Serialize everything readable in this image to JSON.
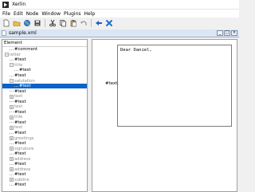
{
  "window": {
    "title": "Xerlin"
  },
  "menu": [
    "File",
    "Edit",
    "Node",
    "Window",
    "Plugins",
    "Help"
  ],
  "toolbar": {
    "buttons": [
      "new-icon",
      "open-icon",
      "globe-icon",
      "save-icon",
      "cut-icon",
      "copy-icon",
      "paste-icon",
      "undo-icon",
      "back-arrow-icon",
      "delete-x-icon"
    ]
  },
  "document": {
    "tab_title": "sample.xml",
    "win_controls": [
      "_",
      "□",
      "×"
    ]
  },
  "tree": {
    "header": "Element",
    "rows": [
      {
        "label": "#comment",
        "indent": 1,
        "type": "leaf",
        "gray": false
      },
      {
        "label": "letter",
        "indent": 0,
        "type": "minus",
        "gray": true
      },
      {
        "label": "#text",
        "indent": 1,
        "type": "leaf",
        "gray": false
      },
      {
        "label": "title",
        "indent": 1,
        "type": "minus",
        "gray": true
      },
      {
        "label": "#text",
        "indent": 2,
        "type": "leaf",
        "gray": false
      },
      {
        "label": "#text",
        "indent": 1,
        "type": "leaf",
        "gray": false
      },
      {
        "label": "salutation",
        "indent": 1,
        "type": "minus",
        "gray": true
      },
      {
        "label": "#text",
        "indent": 2,
        "type": "leaf",
        "gray": false,
        "selected": true
      },
      {
        "label": "#text",
        "indent": 1,
        "type": "leaf",
        "gray": false
      },
      {
        "label": "text",
        "indent": 1,
        "type": "plus",
        "gray": true
      },
      {
        "label": "#text",
        "indent": 1,
        "type": "leaf",
        "gray": false
      },
      {
        "label": "text",
        "indent": 1,
        "type": "plus",
        "gray": true
      },
      {
        "label": "#text",
        "indent": 1,
        "type": "leaf",
        "gray": false
      },
      {
        "label": "title",
        "indent": 1,
        "type": "plus",
        "gray": true
      },
      {
        "label": "#text",
        "indent": 1,
        "type": "leaf",
        "gray": false
      },
      {
        "label": "text",
        "indent": 1,
        "type": "plus",
        "gray": true
      },
      {
        "label": "#text",
        "indent": 1,
        "type": "leaf",
        "gray": false
      },
      {
        "label": "greetings",
        "indent": 1,
        "type": "plus",
        "gray": true
      },
      {
        "label": "#text",
        "indent": 1,
        "type": "leaf",
        "gray": false
      },
      {
        "label": "signature",
        "indent": 1,
        "type": "plus",
        "gray": true
      },
      {
        "label": "#text",
        "indent": 1,
        "type": "leaf",
        "gray": false
      },
      {
        "label": "address",
        "indent": 1,
        "type": "plus",
        "gray": true
      },
      {
        "label": "#text",
        "indent": 1,
        "type": "leaf",
        "gray": false
      },
      {
        "label": "address",
        "indent": 1,
        "type": "plus",
        "gray": true
      },
      {
        "label": "#text",
        "indent": 1,
        "type": "leaf",
        "gray": false
      },
      {
        "label": "subline",
        "indent": 1,
        "type": "plus",
        "gray": true
      },
      {
        "label": "#text",
        "indent": 1,
        "type": "leaf",
        "gray": false
      }
    ]
  },
  "editor": {
    "field_label": "#text:",
    "value": "Dear Daniel,"
  },
  "colors": {
    "selection": "#0a63c8",
    "tab_bg": "#dbe6f4"
  }
}
